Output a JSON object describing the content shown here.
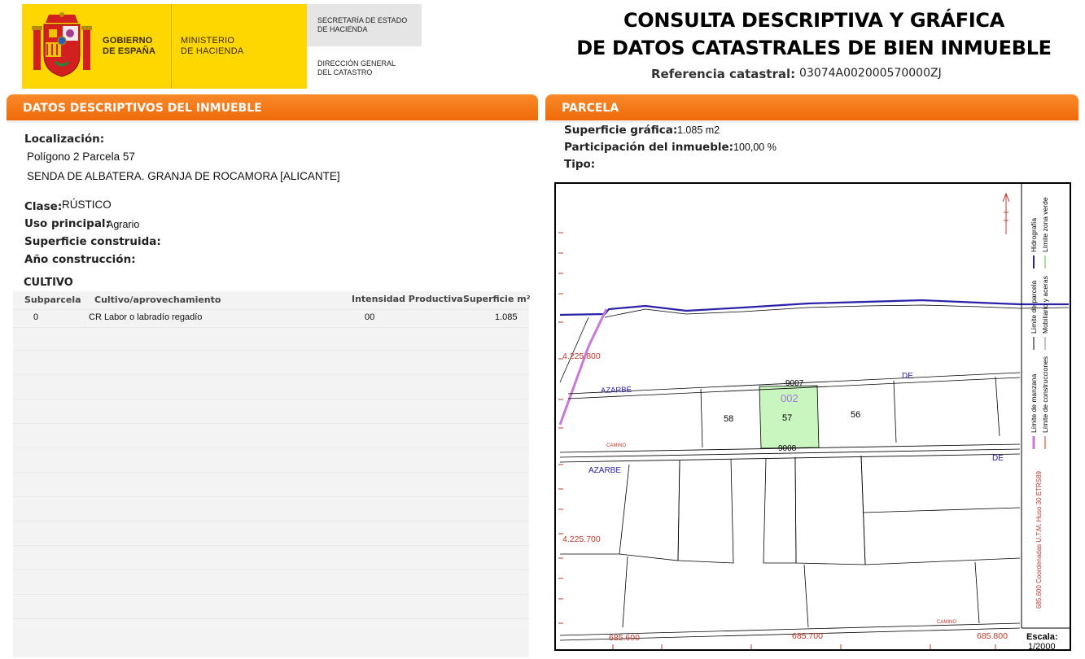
{
  "header": {
    "gobierno": [
      "GOBIERNO",
      "DE ESPAÑA"
    ],
    "ministerio": [
      "MINISTERIO",
      "DE HACIENDA"
    ],
    "secretaria": [
      "SECRETARÍA DE ESTADO",
      "DE HACIENDA"
    ],
    "direccion": [
      "DIRECCIÓN GENERAL",
      "DEL CATASTRO"
    ],
    "title_line1": "CONSULTA DESCRIPTIVA Y GRÁFICA",
    "title_line2": "DE DATOS CATASTRALES DE BIEN INMUEBLE",
    "ref_label": "Referencia catastral:",
    "ref_value": "03074A002000570000ZJ"
  },
  "left_section": {
    "title": "DATOS DESCRIPTIVOS DEL INMUEBLE",
    "localizacion_label": "Localización:",
    "localizacion_line1": "Polígono 2 Parcela 57",
    "localizacion_line2": "SENDA DE ALBATERA. GRANJA DE ROCAMORA [ALICANTE]",
    "clase_label": "Clase:",
    "clase_value": "RÚSTICO",
    "uso_label": "Uso principal:",
    "uso_value": "Agrario",
    "superficie_construida_label": "Superficie construida:",
    "anio_label": "Año construcción:",
    "cultivo_title": "CULTIVO",
    "cultivo_headers": [
      "Subparcela",
      "Cultivo/aprovechamiento",
      "Intensidad Productiva",
      "Superficie m²"
    ],
    "cultivo_rows": [
      [
        "0",
        "CR Labor o labradío regadío",
        "00",
        "1.085"
      ]
    ]
  },
  "right_section": {
    "title": "PARCELA",
    "superficie_label": "Superficie gráfica:",
    "superficie_value": "1.085 m2",
    "participacion_label": "Participación del inmueble:",
    "participacion_value": "100,00 %",
    "tipo_label": "Tipo:"
  },
  "map": {
    "coord_y_top": "4.225.800",
    "coord_y_bottom": "4.225.700",
    "coord_x": [
      "685.600",
      "685.700",
      "685.800"
    ],
    "road_codes": [
      "9007",
      "9008"
    ],
    "poligono": "002",
    "parcels": [
      "58",
      "57",
      "56"
    ],
    "labels": {
      "azarbe_top": "AZARBE",
      "de_top": "DE",
      "camino_mid": "CAMINO",
      "azarbe_bottom": "AZARBE",
      "de_bottom": "DE",
      "camino_bottom": "CAMINO"
    },
    "legend": {
      "hidrografia": "Hidrografía",
      "zona_verde": "Límite zona verde",
      "limite_parcela": "Límite de parcela",
      "mobiliario": "Mobiliario y aceras",
      "limite_manzana": "Límite de manzana",
      "limite_construcciones": "Límite de construcciones",
      "coordenadas": "685.600 Coordenadas U.T.M. Huso 30 ETRS89"
    },
    "escala_label": "Escala:",
    "escala_value": "1/2000",
    "colors": {
      "highlight_parcel": "#c9f5bf",
      "hydro": "#2a21a8",
      "manzana": "#c77ad6",
      "coords": "#c0392b",
      "orange_bar": "#f47a1a"
    }
  }
}
